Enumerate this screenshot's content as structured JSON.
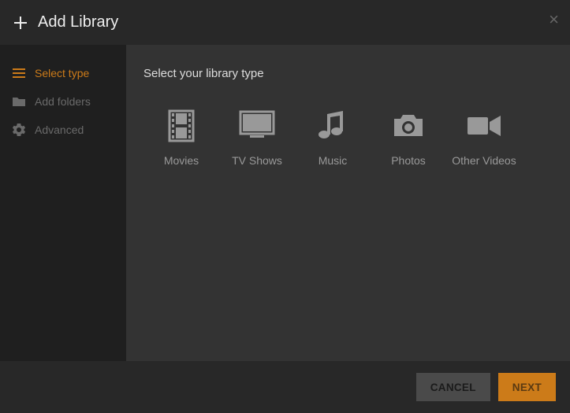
{
  "header": {
    "title": "Add Library"
  },
  "sidebar": {
    "items": [
      {
        "label": "Select type",
        "icon": "list-icon",
        "active": true
      },
      {
        "label": "Add folders",
        "icon": "folder-icon",
        "active": false
      },
      {
        "label": "Advanced",
        "icon": "gear-icon",
        "active": false
      }
    ]
  },
  "main": {
    "prompt": "Select your library type",
    "types": [
      {
        "label": "Movies",
        "icon": "film-icon"
      },
      {
        "label": "TV Shows",
        "icon": "tv-icon"
      },
      {
        "label": "Music",
        "icon": "music-icon"
      },
      {
        "label": "Photos",
        "icon": "camera-icon"
      },
      {
        "label": "Other Videos",
        "icon": "video-camera-icon"
      }
    ]
  },
  "footer": {
    "cancel_label": "CANCEL",
    "next_label": "NEXT"
  },
  "colors": {
    "accent": "#cc7b19",
    "icon": "#999999"
  }
}
